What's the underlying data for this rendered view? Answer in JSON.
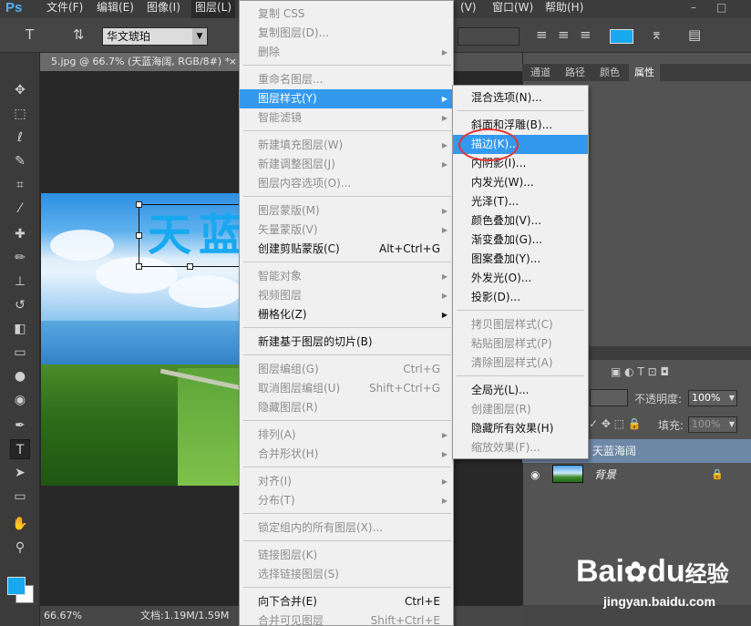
{
  "app": {
    "logo": "Ps",
    "menubar": [
      "文件(F)",
      "编辑(E)",
      "图像(I)",
      "图层(L)",
      "(V)",
      "窗口(W)",
      "帮助(H)"
    ]
  },
  "options": {
    "font_family": "华文琥珀",
    "color_swatch": "#17a8f0"
  },
  "document": {
    "tab_title": "5.jpg @ 66.7% (天蓝海阔, RGB/8#) *",
    "tab_close": "×",
    "text_chars": [
      "天",
      "蓝"
    ],
    "zoom": "66.67%",
    "doc_size": "文档:1.19M/1.59M"
  },
  "right_panel": {
    "tabs": [
      "通道",
      "路径",
      "颜色",
      "属性"
    ],
    "opacity_label": "不透明度:",
    "opacity_value": "100%",
    "fill_label": "填充:",
    "fill_value": "100%",
    "layers": [
      {
        "name": "天蓝海阔",
        "selected": true
      },
      {
        "name": "背景",
        "selected": false,
        "locked": true
      }
    ]
  },
  "layer_menu": {
    "items": [
      {
        "label": "复制 CSS",
        "disabled": true
      },
      {
        "label": "复制图层(D)...",
        "disabled": true
      },
      {
        "label": "删除",
        "disabled": true,
        "submenu": true
      },
      {
        "label": "重命名图层...",
        "disabled": true
      },
      {
        "label": "图层样式(Y)",
        "highlight": true,
        "submenu": true
      },
      {
        "label": "智能滤镜",
        "disabled": true,
        "submenu": true
      },
      {
        "label": "新建填充图层(W)",
        "disabled": true,
        "submenu": true
      },
      {
        "label": "新建调整图层(J)",
        "disabled": true,
        "submenu": true
      },
      {
        "label": "图层内容选项(O)...",
        "disabled": true
      },
      {
        "label": "图层蒙版(M)",
        "disabled": true,
        "submenu": true
      },
      {
        "label": "矢量蒙版(V)",
        "disabled": true,
        "submenu": true
      },
      {
        "label": "创建剪贴蒙版(C)",
        "shortcut": "Alt+Ctrl+G"
      },
      {
        "label": "智能对象",
        "disabled": true,
        "submenu": true
      },
      {
        "label": "视频图层",
        "disabled": true,
        "submenu": true
      },
      {
        "label": "栅格化(Z)",
        "submenu": true
      },
      {
        "label": "新建基于图层的切片(B)"
      },
      {
        "label": "图层编组(G)",
        "disabled": true,
        "shortcut": "Ctrl+G"
      },
      {
        "label": "取消图层编组(U)",
        "disabled": true,
        "shortcut": "Shift+Ctrl+G"
      },
      {
        "label": "隐藏图层(R)",
        "disabled": true
      },
      {
        "label": "排列(A)",
        "disabled": true,
        "submenu": true
      },
      {
        "label": "合并形状(H)",
        "disabled": true,
        "submenu": true
      },
      {
        "label": "对齐(I)",
        "disabled": true,
        "submenu": true
      },
      {
        "label": "分布(T)",
        "disabled": true,
        "submenu": true
      },
      {
        "label": "锁定组内的所有图层(X)...",
        "disabled": true
      },
      {
        "label": "链接图层(K)",
        "disabled": true
      },
      {
        "label": "选择链接图层(S)",
        "disabled": true
      },
      {
        "label": "向下合并(E)",
        "shortcut": "Ctrl+E"
      },
      {
        "label": "合并可见图层",
        "disabled": true,
        "shortcut": "Shift+Ctrl+E"
      }
    ]
  },
  "style_menu": {
    "items": [
      {
        "label": "混合选项(N)..."
      },
      {
        "label": "斜面和浮雕(B)..."
      },
      {
        "label": "描边(K)...",
        "highlight": true
      },
      {
        "label": "内阴影(I)..."
      },
      {
        "label": "内发光(W)..."
      },
      {
        "label": "光泽(T)..."
      },
      {
        "label": "颜色叠加(V)..."
      },
      {
        "label": "渐变叠加(G)..."
      },
      {
        "label": "图案叠加(Y)..."
      },
      {
        "label": "外发光(O)..."
      },
      {
        "label": "投影(D)..."
      },
      {
        "label": "拷贝图层样式(C)",
        "disabled": true
      },
      {
        "label": "粘贴图层样式(P)",
        "disabled": true
      },
      {
        "label": "清除图层样式(A)",
        "disabled": true
      },
      {
        "label": "全局光(L)..."
      },
      {
        "label": "创建图层(R)",
        "disabled": true
      },
      {
        "label": "隐藏所有效果(H)"
      },
      {
        "label": "缩放效果(F)...",
        "disabled": true
      }
    ]
  },
  "watermark": {
    "brand": "Bai",
    "brand2": "du",
    "brand_cn": "经验",
    "url": "jingyan.baidu.com"
  }
}
